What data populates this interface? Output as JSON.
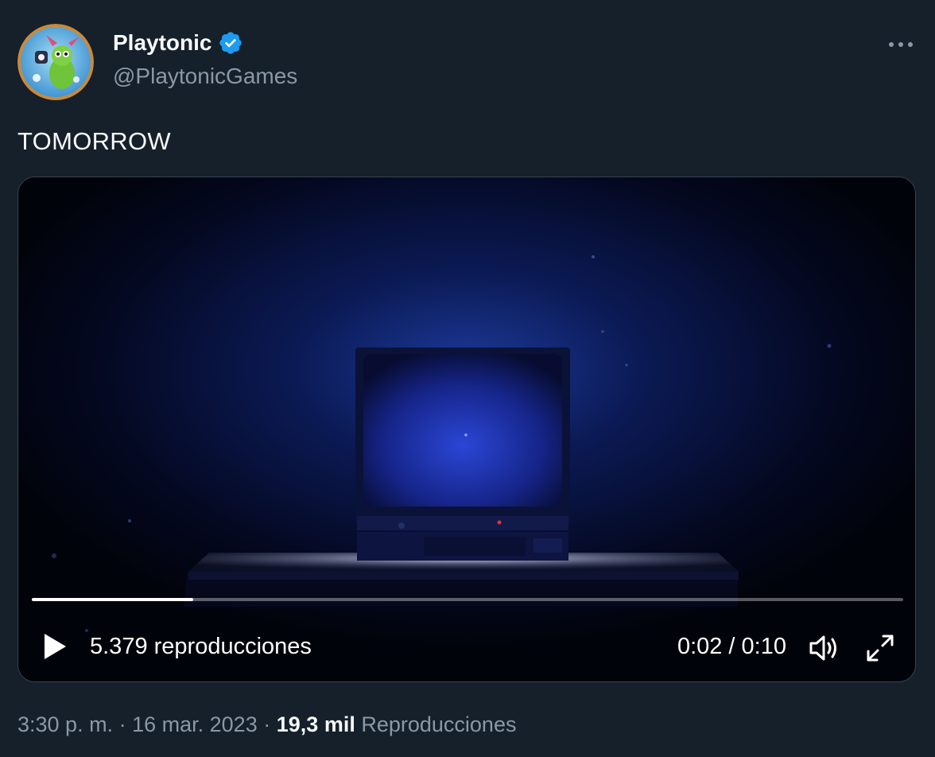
{
  "author": {
    "display_name": "Playtonic",
    "handle": "@PlaytonicGames",
    "verified": true
  },
  "tweet": {
    "text": "TOMORROW"
  },
  "video": {
    "views_label": "5.379 reproducciones",
    "time_label": "0:02 / 0:10",
    "progress": 0.185
  },
  "meta": {
    "time": "3:30 p. m.",
    "separator_1": "·",
    "date": "16 mar. 2023",
    "separator_2": "·",
    "views_count": "19,3 mil",
    "views_label": "Reproducciones"
  },
  "icons": {
    "verified": "verified-badge-icon",
    "more": "more-horizontal-icon",
    "play": "play-icon",
    "volume": "volume-icon",
    "fullscreen": "fullscreen-icon"
  },
  "colors": {
    "background": "#15202b",
    "verified_blue": "#1d9bf0",
    "secondary_text": "#8b98a5"
  }
}
